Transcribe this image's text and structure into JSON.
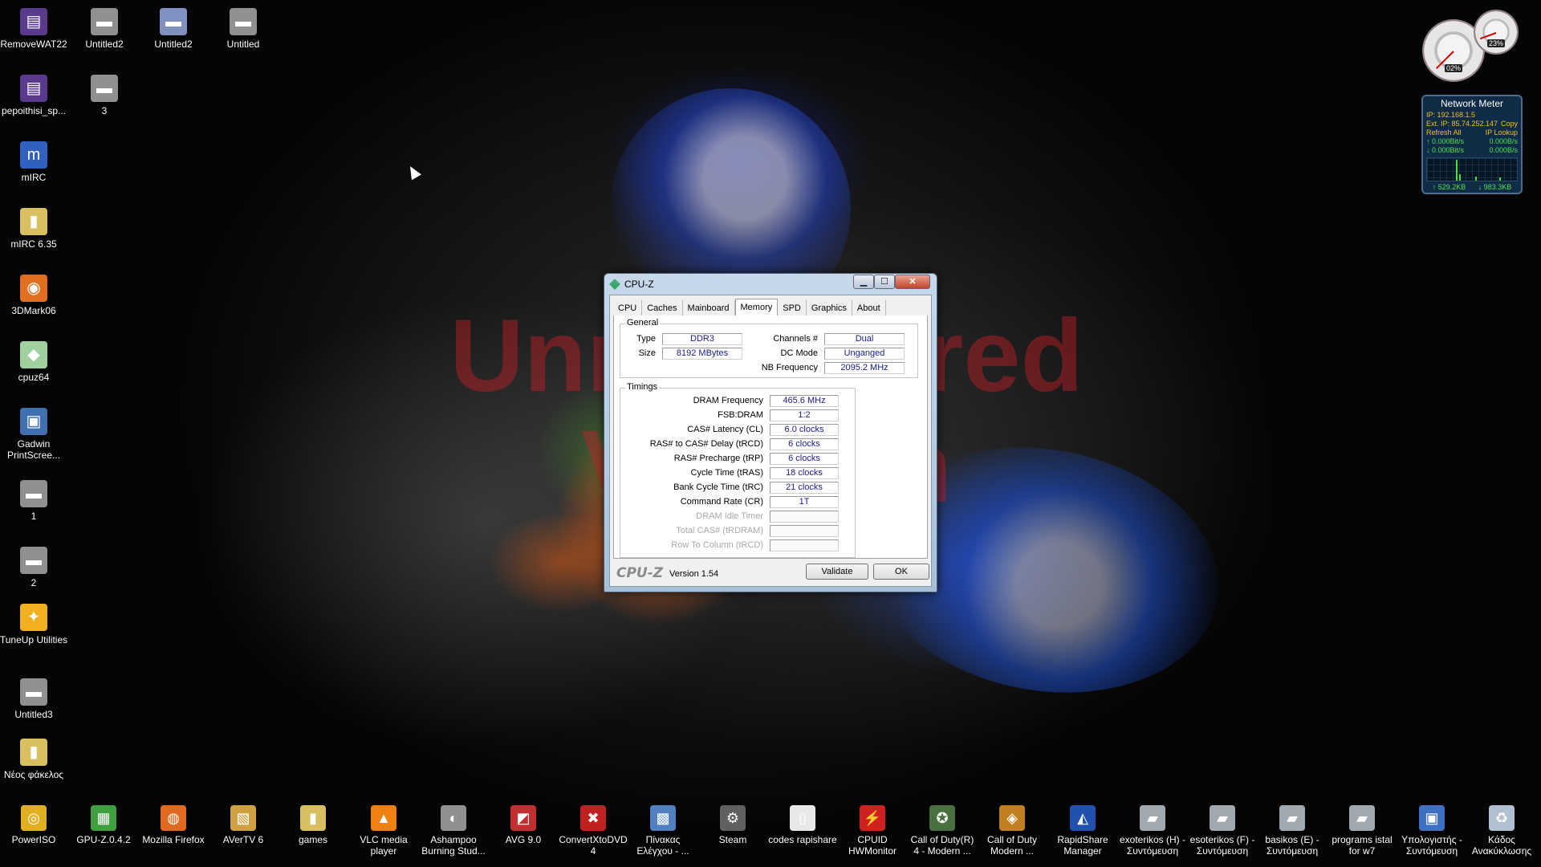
{
  "desktop": {
    "icons_left": [
      {
        "label": "RemoveWAT22",
        "icon": "winrar-archive-icon",
        "color": "#5a3a8c"
      },
      {
        "label": "pepoithisi_sp...",
        "icon": "winrar-archive-icon",
        "color": "#5a3a8c"
      },
      {
        "label": "mIRC",
        "icon": "mirc-icon",
        "color": "#3060c0"
      },
      {
        "label": "mIRC 6.35",
        "icon": "zip-folder-icon",
        "color": "#d8c060"
      },
      {
        "label": "3DMark06",
        "icon": "3dmark-icon",
        "color": "#e07020"
      },
      {
        "label": "cpuz64",
        "icon": "cpuz-icon",
        "color": "#a0d0a0"
      },
      {
        "label": "Gadwin PrintScree...",
        "icon": "printscreen-icon",
        "color": "#4070b0"
      },
      {
        "label": "1",
        "icon": "image-file-icon",
        "color": "#909090"
      },
      {
        "label": "2",
        "icon": "image-file-icon",
        "color": "#909090"
      },
      {
        "label": "TuneUp Utilities",
        "icon": "tuneup-icon",
        "color": "#f0b020"
      },
      {
        "label": "Untitled3",
        "icon": "image-file-icon",
        "color": "#909090"
      },
      {
        "label": "Νέος φάκελος",
        "icon": "zip-folder-icon",
        "color": "#d8c060"
      }
    ],
    "icons_col2": [
      {
        "label": "Untitled2",
        "icon": "image-file-icon",
        "color": "#909090"
      },
      {
        "label": "3",
        "icon": "image-file-icon",
        "color": "#909090"
      }
    ],
    "icons_top": [
      {
        "label": "Untitled2",
        "icon": "image-file-icon",
        "color": "#8090c0"
      },
      {
        "label": "Untitled",
        "icon": "image-file-icon",
        "color": "#909090"
      }
    ],
    "watermark": [
      "Unregistered",
      "Version"
    ]
  },
  "gadgets": {
    "cpu_meter": {
      "cpu_pct": "02%",
      "ram_pct": "23%"
    },
    "network_meter": {
      "title": "Network Meter",
      "ip": "IP: 192.168.1.5",
      "ext_ip": "Ext. IP: 85.74.252.147",
      "copy": "Copy",
      "refresh_all": "Refresh All",
      "ip_lookup": "IP Lookup",
      "up_rate": "↑ 0.000Bit/s",
      "up_rate2": "0.000B/s",
      "down_rate": "↓ 0.000Bit/s",
      "down_rate2": "0.000B/s",
      "total_up": "↑ 529.2KB",
      "total_down": "↓ 983.3KB"
    }
  },
  "cpuz": {
    "title": "CPU-Z",
    "tabs": [
      "CPU",
      "Caches",
      "Mainboard",
      "Memory",
      "SPD",
      "Graphics",
      "About"
    ],
    "active_tab": "Memory",
    "general": {
      "title": "General",
      "type_label": "Type",
      "type_value": "DDR3",
      "size_label": "Size",
      "size_value": "8192 MBytes",
      "channels_label": "Channels #",
      "channels_value": "Dual",
      "dcmode_label": "DC Mode",
      "dcmode_value": "Unganged",
      "nbfreq_label": "NB Frequency",
      "nbfreq_value": "2095.2 MHz"
    },
    "timings": {
      "title": "Timings",
      "rows": [
        {
          "label": "DRAM Frequency",
          "value": "465.6 MHz",
          "enabled": true
        },
        {
          "label": "FSB:DRAM",
          "value": "1:2",
          "enabled": true
        },
        {
          "label": "CAS# Latency (CL)",
          "value": "6.0 clocks",
          "enabled": true
        },
        {
          "label": "RAS# to CAS# Delay (tRCD)",
          "value": "6 clocks",
          "enabled": true
        },
        {
          "label": "RAS# Precharge (tRP)",
          "value": "6 clocks",
          "enabled": true
        },
        {
          "label": "Cycle Time (tRAS)",
          "value": "18 clocks",
          "enabled": true
        },
        {
          "label": "Bank Cycle Time (tRC)",
          "value": "21 clocks",
          "enabled": true
        },
        {
          "label": "Command Rate (CR)",
          "value": "1T",
          "enabled": true
        },
        {
          "label": "DRAM Idle Timer",
          "value": "",
          "enabled": false
        },
        {
          "label": "Total CAS# (tRDRAM)",
          "value": "",
          "enabled": false
        },
        {
          "label": "Row To Column (tRCD)",
          "value": "",
          "enabled": false
        }
      ]
    },
    "brand": "CPU-Z",
    "version": "Version 1.54",
    "validate_label": "Validate",
    "ok_label": "OK",
    "minimize": "▁",
    "maximize": "☐",
    "close": "✕"
  },
  "taskbar_icons": [
    {
      "label": "PowerISO",
      "icon": "poweriso-icon",
      "color": "#e0b020"
    },
    {
      "label": "GPU-Z.0.4.2",
      "icon": "gpuz-icon",
      "color": "#40a040"
    },
    {
      "label": "Mozilla Firefox",
      "icon": "firefox-icon",
      "color": "#e06a20"
    },
    {
      "label": "AVerTV 6",
      "icon": "avertv-icon",
      "color": "#d0a040"
    },
    {
      "label": "games",
      "icon": "zip-folder-icon",
      "color": "#d8c060"
    },
    {
      "label": "VLC media player",
      "icon": "vlc-icon",
      "color": "#f08010"
    },
    {
      "label": "Ashampoo Burning Stud...",
      "icon": "ashampoo-icon",
      "color": "#909090"
    },
    {
      "label": "AVG 9.0",
      "icon": "avg-icon",
      "color": "#c03030"
    },
    {
      "label": "ConvertXtoDVD 4",
      "icon": "convertx-icon",
      "color": "#c02020"
    },
    {
      "label": "Πίνακας Ελέγχου - ...",
      "icon": "control-panel-icon",
      "color": "#5080c0"
    },
    {
      "label": "Steam",
      "icon": "steam-icon",
      "color": "#606060"
    },
    {
      "label": "codes rapishare",
      "icon": "text-file-icon",
      "color": "#e8e8e8"
    },
    {
      "label": "CPUID HWMonitor",
      "icon": "hwmonitor-icon",
      "color": "#d02020"
    },
    {
      "label": "Call of Duty(R) 4 - Modern ...",
      "icon": "cod4-icon",
      "color": "#4a7040"
    },
    {
      "label": "Call of Duty Modern ...",
      "icon": "codmw-icon",
      "color": "#c08020"
    },
    {
      "label": "RapidShare Manager",
      "icon": "rapidshare-icon",
      "color": "#2050b0"
    },
    {
      "label": "exoterikos (H) - Συντόμευση",
      "icon": "drive-shortcut-icon",
      "color": "#a0a8b0"
    },
    {
      "label": "esoterikos (F) - Συντόμευση",
      "icon": "drive-shortcut-icon",
      "color": "#a0a8b0"
    },
    {
      "label": "basikos (E) - Συντόμευση",
      "icon": "drive-shortcut-icon",
      "color": "#a0a8b0"
    },
    {
      "label": "programs istal for w7",
      "icon": "drive-shortcut-icon",
      "color": "#a0a8b0"
    },
    {
      "label": "Υπολογιστής - Συντόμευση",
      "icon": "computer-icon",
      "color": "#4070c0"
    },
    {
      "label": "Κάδος Ανακύκλωσης",
      "icon": "recycle-bin-icon",
      "color": "#b0c0d0"
    }
  ]
}
